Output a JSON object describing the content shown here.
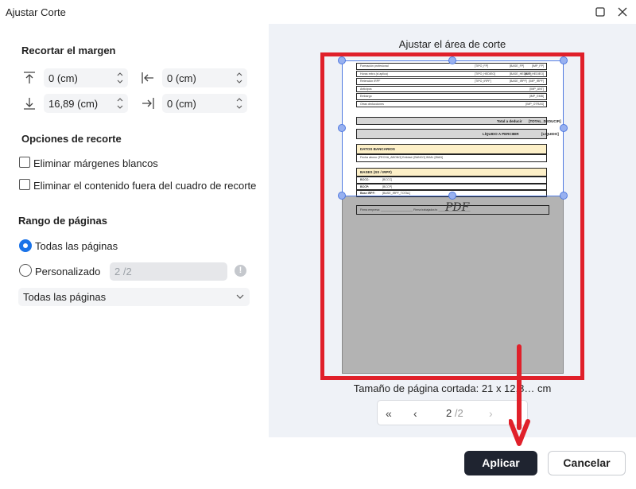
{
  "window": {
    "title": "Ajustar Corte"
  },
  "margins": {
    "section_title": "Recortar el margen",
    "top": "0 (cm)",
    "left": "0 (cm)",
    "bottom": "16,89 (cm)",
    "right": "0 (cm)"
  },
  "crop_options": {
    "section_title": "Opciones de recorte",
    "remove_white_margins": "Eliminar márgenes blancos",
    "remove_outside_content": "Eliminar el contenido fuera del cuadro de recorte"
  },
  "page_range": {
    "section_title": "Rango de páginas",
    "all_pages": "Todas las páginas",
    "custom": "Personalizado",
    "custom_value": "2 /2",
    "selected": "all_pages",
    "dropdown_value": "Todas las páginas"
  },
  "preview": {
    "title": "Ajustar el área de corte",
    "cropped_size": "Tamaño de página cortada: 21 x 12,8… cm",
    "current_page": "2",
    "total_pages": "/2",
    "doc": {
      "rows": [
        [
          "Formación profesional",
          "[TIPO_FP]",
          "[BASE_FP]",
          "[IMP_FP]"
        ],
        [
          "Horas extra (si aplica)",
          "[TIPO_HEDIEO]",
          "[BASE_HEDIEO]",
          "[IMP_HEDIEO]"
        ],
        [
          "Retención IRPF",
          "[TIPO_IRPF]",
          "[BASE_IRPF]",
          "[IMP_IRPF]"
        ],
        [
          "Anticipos",
          "",
          "",
          "[IMP_ANT]"
        ],
        [
          "Embargo",
          "",
          "",
          "[IMP_EMB]"
        ],
        [
          "Otras deducciones",
          "",
          "",
          "[IMP_OTRAS]"
        ]
      ],
      "total_label": "Total a deducir",
      "total_value": "[TOTAL_DEDUCIR]",
      "liquid_label": "LÍQUIDO A PERCIBIR",
      "liquid_value": "[LIQUIDO]",
      "bank_title": "DATOS BANCARIOS",
      "bank_line": "Fecha abono: [FECHA_ABONO]   Entidad: [BANCO]   IBAN: [IBAN]",
      "bases_title": "BASES (SS / IRPF)",
      "bases_rows": [
        [
          "BCCC:",
          "[BCCC]"
        ],
        [
          "BCCP:",
          "[BCCP]"
        ],
        [
          "Base IRPF:",
          "[BASE_IRPF_TOTAL]"
        ]
      ],
      "sign_line": "Firma empresa: ____________________   Firma trabajador/a: ____________________",
      "watermark": "PDF"
    }
  },
  "buttons": {
    "apply": "Aplicar",
    "cancel": "Cancelar"
  },
  "colors": {
    "accent": "#1a73e8",
    "highlight": "#e0202a",
    "crop_border": "#4f79e0",
    "apply_bg": "#1f2430"
  }
}
